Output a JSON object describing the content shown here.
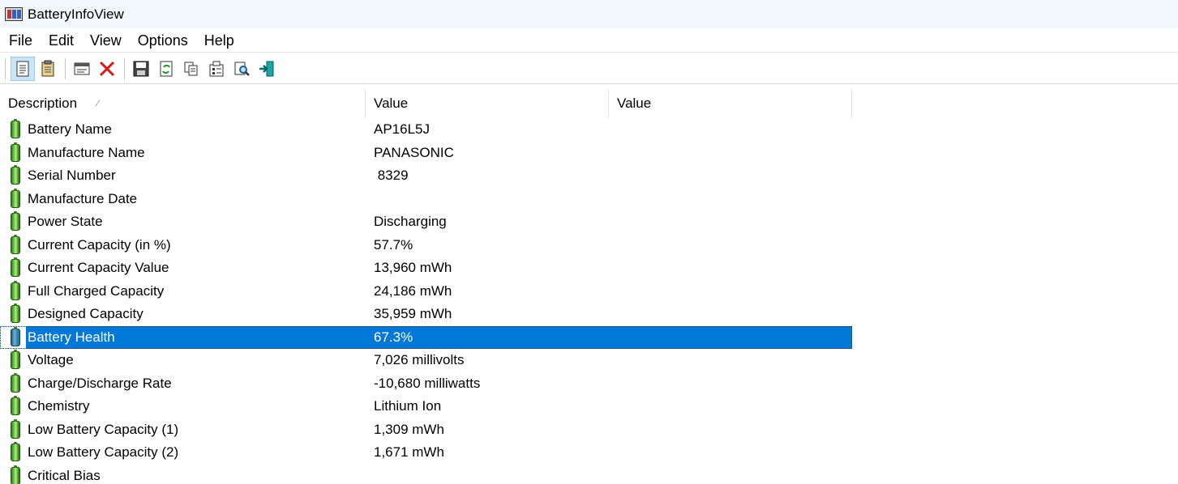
{
  "window": {
    "title": "BatteryInfoView"
  },
  "menu": [
    "File",
    "Edit",
    "View",
    "Options",
    "Help"
  ],
  "toolbar": {
    "buttons": [
      "properties-list-icon",
      "html-report-icon",
      "window-icon",
      "delete-icon",
      "save-icon",
      "refresh-icon",
      "copy-icon",
      "properties-icon",
      "find-icon",
      "exit-icon"
    ]
  },
  "table": {
    "columns": [
      "Description",
      "Value",
      "Value"
    ],
    "selected_index": 9,
    "rows": [
      {
        "label": "Battery Name",
        "value": "AP16L5J"
      },
      {
        "label": "Manufacture Name",
        "value": "PANASONIC"
      },
      {
        "label": "Serial Number",
        "value": " 8329"
      },
      {
        "label": "Manufacture Date",
        "value": ""
      },
      {
        "label": "Power State",
        "value": "Discharging"
      },
      {
        "label": "Current Capacity (in %)",
        "value": "57.7%"
      },
      {
        "label": "Current Capacity Value",
        "value": "13,960 mWh"
      },
      {
        "label": "Full Charged Capacity",
        "value": "24,186 mWh"
      },
      {
        "label": "Designed Capacity",
        "value": "35,959 mWh"
      },
      {
        "label": "Battery Health",
        "value": "67.3%"
      },
      {
        "label": "Voltage",
        "value": "7,026 millivolts"
      },
      {
        "label": "Charge/Discharge Rate",
        "value": "-10,680 milliwatts"
      },
      {
        "label": "Chemistry",
        "value": "Lithium Ion"
      },
      {
        "label": "Low Battery Capacity (1)",
        "value": "1,309 mWh"
      },
      {
        "label": "Low Battery Capacity (2)",
        "value": "1,671 mWh"
      },
      {
        "label": "Critical Bias",
        "value": ""
      }
    ]
  },
  "colors": {
    "selection": "#0078d7",
    "titlebar": "#f3f8fc"
  }
}
